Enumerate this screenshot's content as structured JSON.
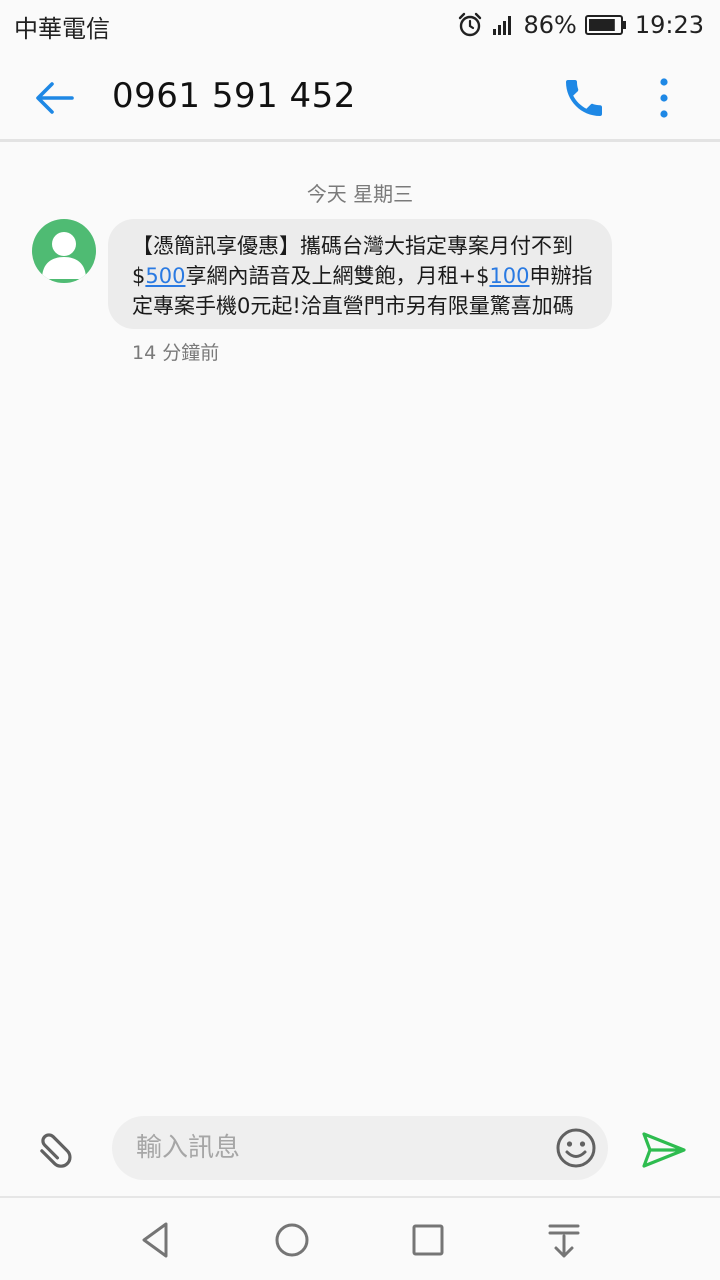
{
  "status_bar": {
    "carrier": "中華電信",
    "battery_percent": "86%",
    "battery_level": 0.86,
    "time": "19:23",
    "icons": [
      "alarm-icon",
      "signal-icon",
      "battery-icon"
    ]
  },
  "app_bar": {
    "title": "0961 591 452",
    "accent_color": "#1e88e5",
    "icons": [
      "back-arrow-icon",
      "phone-icon",
      "more-vert-icon"
    ]
  },
  "conversation": {
    "date_separator": "今天 星期三",
    "message": {
      "line1": "【憑簡訊享優惠】攜碼台灣大指定專案月付不到",
      "line2_prefix": "$",
      "line2_link1": "500",
      "line2_middle": "享網內語音及上網雙飽，月租+$",
      "line2_link2": "100",
      "line2_suffix": "申辦指",
      "line3": "定專案手機0元起!洽直營門市另有限量驚喜加碼",
      "time": "14 分鐘前",
      "link_color": "#2a7ae2"
    },
    "avatar_color": "#4fbb73"
  },
  "composer": {
    "placeholder": "輸入訊息",
    "value": "",
    "send_color": "#2ebc4f",
    "icons": [
      "paperclip-icon",
      "emoji-icon",
      "send-icon"
    ]
  },
  "nav_bar": {
    "icons": [
      "back-triangle-icon",
      "home-circle-icon",
      "recents-square-icon",
      "notification-pull-icon"
    ]
  }
}
